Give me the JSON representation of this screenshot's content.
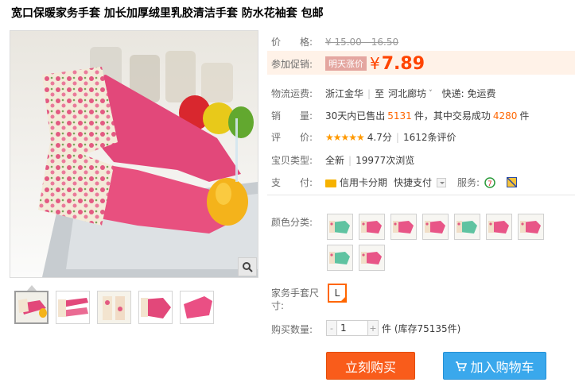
{
  "title": "宽口保暖家务手套 加长加厚绒里乳胶清洁手套 防水花袖套 包邮",
  "price": {
    "label": "价　　格:",
    "value": "¥ 15.00 - 16.50"
  },
  "promo": {
    "label": "参加促销:",
    "tag": "明天涨价",
    "yen": "¥",
    "value": "7.89"
  },
  "shipping": {
    "label": "物流运费:",
    "from": "浙江金华",
    "sep": "|",
    "to_prefix": "至",
    "to": "河北廊坊",
    "caret": "˅",
    "fee": "快递: 免运费"
  },
  "sales": {
    "label": "销　　量:",
    "prefix": "30天内已售出",
    "count": "5131",
    "mid": "件，其中交易成功",
    "success": "4280",
    "suffix": "件"
  },
  "rating": {
    "label": "评　　价:",
    "stars": "★★★★★",
    "score": "4.7分",
    "sep": "|",
    "reviews": "1612条评价"
  },
  "type": {
    "label": "宝贝类型:",
    "value": "全新",
    "sep": "|",
    "views": "19977次浏览"
  },
  "payment": {
    "label": "支　　付:",
    "credit": "信用卡分期",
    "fast": "快捷支付",
    "service_label": "服务:"
  },
  "color": {
    "label": "颜色分类:",
    "swatches": [
      "green",
      "pink",
      "pink",
      "pink",
      "green",
      "pink",
      "pink",
      "green",
      "pink"
    ]
  },
  "size": {
    "label": "家务手套尺寸:",
    "value": "L"
  },
  "quantity": {
    "label": "购买数量:",
    "value": "1",
    "minus": "-",
    "plus": "+",
    "stock": "件 (库存75135件)"
  },
  "buttons": {
    "buy": "立刻购买",
    "cart": "加入购物车"
  },
  "colors": {
    "accent": "#ff4400",
    "buy": "#f95c1b",
    "cart": "#3aa8ec"
  }
}
